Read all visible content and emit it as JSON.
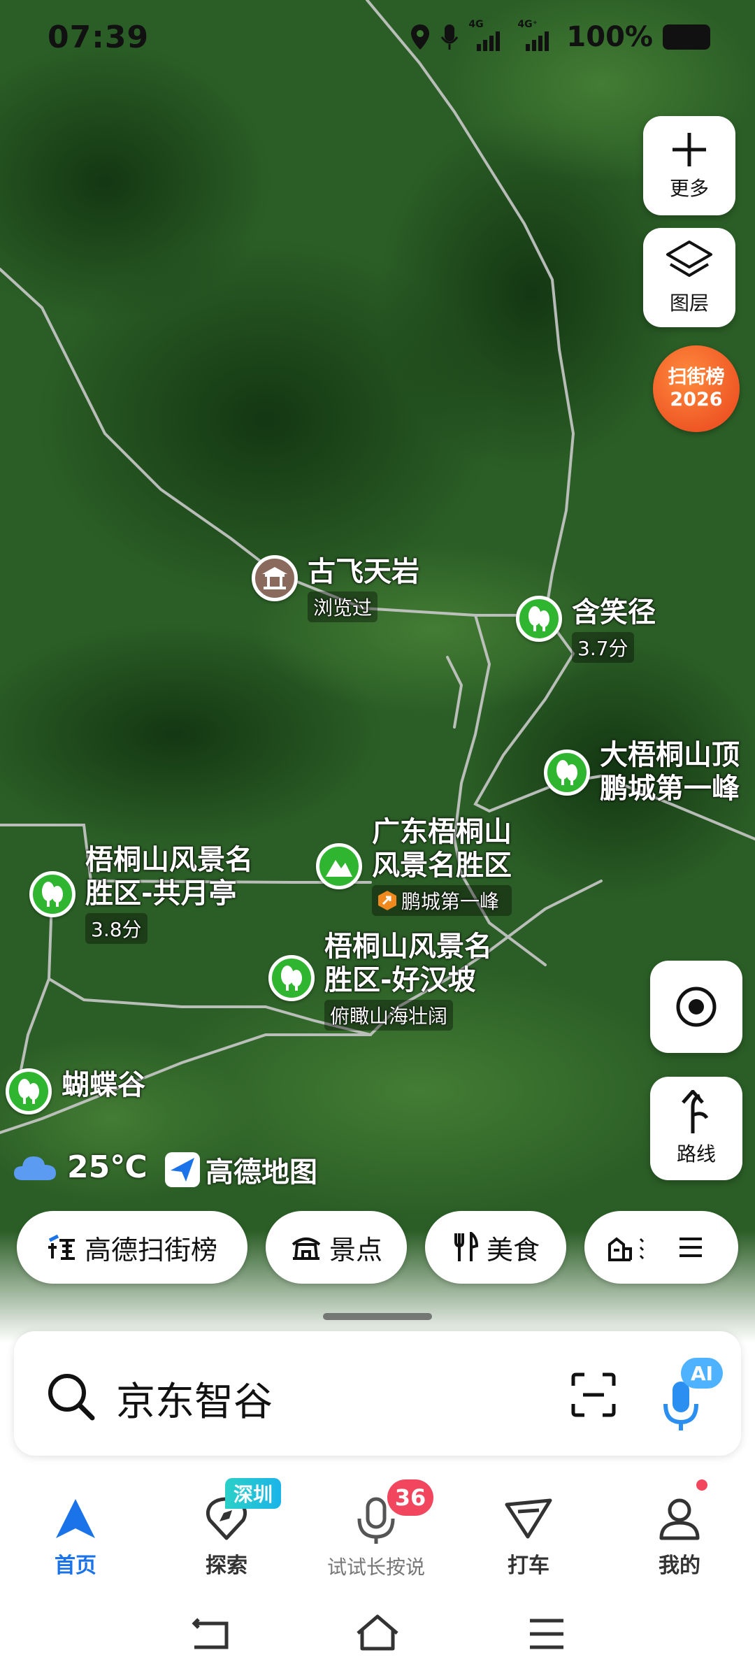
{
  "status_bar": {
    "time": "07:39",
    "net1": "4G",
    "net2": "4G⁺",
    "battery": "100%"
  },
  "map_tools": {
    "more": "更多",
    "layers": "图层",
    "ranking_badge_line1": "扫街榜",
    "ranking_badge_line2": "2026",
    "route": "路线"
  },
  "pois": [
    {
      "name_lines": [
        "古飞天岩"
      ],
      "sub": "浏览过"
    },
    {
      "name_lines": [
        "含笑径"
      ],
      "sub": "3.7分"
    },
    {
      "name_lines": [
        "大梧桐山顶",
        "鹏城第一峰"
      ],
      "sub": ""
    },
    {
      "name_lines": [
        "广东梧桐山",
        "风景名胜区"
      ],
      "sub": "鹏城第一峰"
    },
    {
      "name_lines": [
        "梧桐山风景名",
        "胜区-共月亭"
      ],
      "sub": "3.8分"
    },
    {
      "name_lines": [
        "梧桐山风景名",
        "胜区-好汉坡"
      ],
      "sub": "俯瞰山海壮阔"
    },
    {
      "name_lines": [
        "蝴蝶谷"
      ],
      "sub": ""
    }
  ],
  "weather": {
    "temp": "25℃"
  },
  "brand": {
    "name": "高德地图"
  },
  "chips": [
    {
      "label": "高德扫街榜"
    },
    {
      "label": "景点"
    },
    {
      "label": "美食"
    }
  ],
  "search": {
    "value": "京东智谷",
    "ai_badge": "AI"
  },
  "bottom_nav": {
    "items": [
      {
        "label": "首页"
      },
      {
        "label": "探索",
        "badge": "深圳"
      },
      {
        "label": "试试长按说",
        "badge": "36"
      },
      {
        "label": "打车"
      },
      {
        "label": "我的"
      }
    ]
  },
  "colors": {
    "accent": "#1a73e8",
    "poi_green": "#2fb52f",
    "badge_red": "#f05a28",
    "map_green": "#245c24"
  }
}
